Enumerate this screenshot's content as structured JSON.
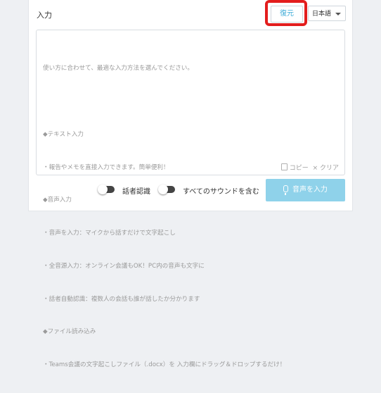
{
  "header": {
    "title": "入力"
  },
  "toolbar": {
    "restore_label": "復元",
    "language": "日本語"
  },
  "editor": {
    "placeholder_lines": [
      "使い方に合わせて、最適な入力方法を選んでください。",
      "",
      "◆テキスト入力",
      "・報告やメモを直接入力できます。簡単便利！",
      "◆音声入力",
      "・音声を入力：マイクから話すだけで文字起こし",
      "・全音源入力：オンライン会議もOK！PC内の音声も文字に",
      "・話者自動認識：複数人の会話も誰が話したか分かります",
      "◆ファイル読み込み",
      "・Teams会議の文字起こしファイル（.docx）を 入力欄にドラッグ＆ドロップするだけ！"
    ],
    "copy_label": "コピー",
    "clear_label": "クリア",
    "clear_prefix": "×"
  },
  "footer": {
    "speaker_toggle_label": "話者認識",
    "all_sound_toggle_label": "すべてのサウンドを含む",
    "voice_input_label": "音声を入力"
  },
  "colors": {
    "accent": "#3aa9d6",
    "voice_button": "#8fd2ea",
    "highlight": "#e31d1d"
  }
}
